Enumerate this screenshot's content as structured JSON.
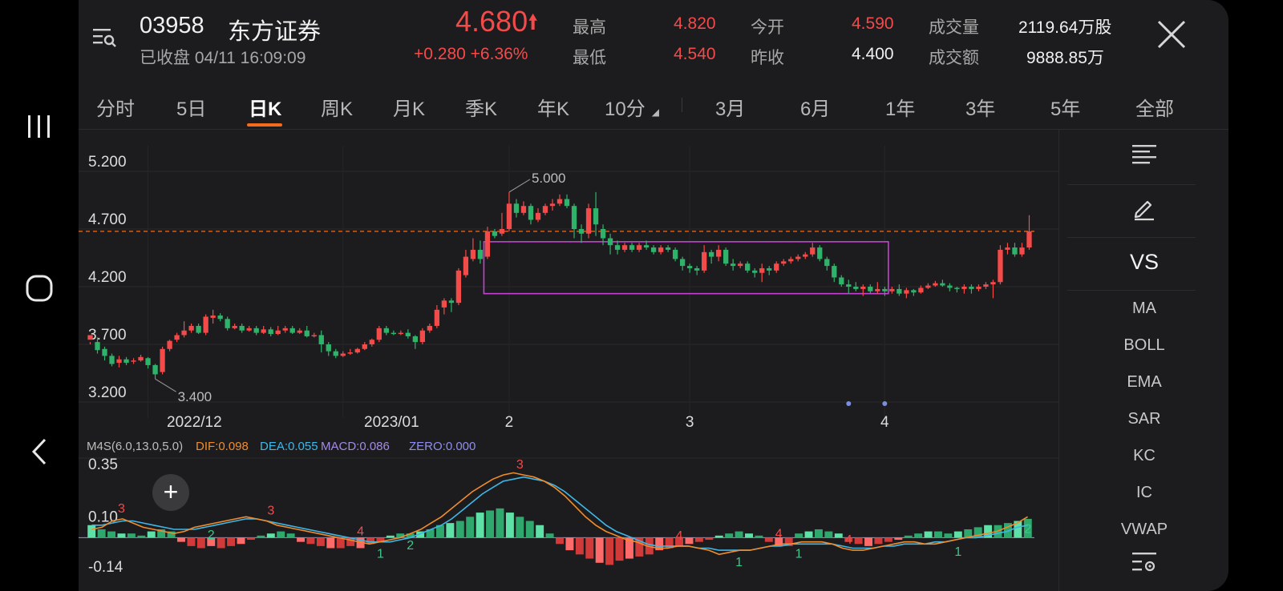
{
  "stock": {
    "code": "03958",
    "name": "东方证券",
    "status": "已收盘 04/11 16:09:09",
    "price": "4.680",
    "change": "+0.280",
    "change_pct": "+6.36%"
  },
  "stats": {
    "high_label": "最高",
    "high": "4.820",
    "low_label": "最低",
    "low": "4.540",
    "open_label": "今开",
    "open": "4.590",
    "prev_label": "昨收",
    "prev": "4.400",
    "vol_label": "成交量",
    "vol": "2119.64万股",
    "amt_label": "成交额",
    "amt": "9888.85万"
  },
  "tabs": [
    "分时",
    "5日",
    "日K",
    "周K",
    "月K",
    "季K",
    "年K",
    "10分",
    "3月",
    "6月",
    "1年",
    "3年",
    "5年",
    "全部"
  ],
  "active_tab": "日K",
  "tools": {
    "vs": "VS",
    "indicators": [
      "MA",
      "BOLL",
      "EMA",
      "SAR",
      "KC",
      "IC",
      "VWAP"
    ]
  },
  "colors": {
    "up": "#f34a4a",
    "down": "#2fb36b",
    "accent": "#f56a1c",
    "box": "#c83fd6",
    "dif": "#f08c2c",
    "dea": "#3fb7e8",
    "macd": "#a48be3",
    "zero": "#8e8ef0"
  },
  "chart_data": {
    "type": "candlestick",
    "y_ticks": [
      "5.200",
      "4.700",
      "4.200",
      "3.700",
      "3.200"
    ],
    "y_tick_values": [
      5.2,
      4.7,
      4.2,
      3.7,
      3.2
    ],
    "ylim": [
      3.2,
      5.2
    ],
    "x_labels": [
      "2022/12",
      "2023/01",
      "2",
      "3",
      "4"
    ],
    "reference_price": 4.68,
    "annotations": [
      {
        "text": "5.000",
        "value": 5.0
      },
      {
        "text": "3.400",
        "value": 3.4
      }
    ],
    "box": {
      "from_index": 55,
      "to_index": 110,
      "top": 4.59,
      "bottom": 4.14
    },
    "candles": [
      [
        3.74,
        3.78,
        3.72,
        3.7
      ],
      [
        3.72,
        3.65,
        3.76,
        3.62
      ],
      [
        3.66,
        3.6,
        3.68,
        3.56
      ],
      [
        3.6,
        3.53,
        3.62,
        3.51
      ],
      [
        3.54,
        3.57,
        3.6,
        3.5
      ],
      [
        3.57,
        3.54,
        3.59,
        3.52
      ],
      [
        3.55,
        3.56,
        3.58,
        3.53
      ],
      [
        3.56,
        3.59,
        3.61,
        3.55
      ],
      [
        3.58,
        3.52,
        3.59,
        3.49
      ],
      [
        3.52,
        3.44,
        3.53,
        3.4
      ],
      [
        3.46,
        3.66,
        3.68,
        3.44
      ],
      [
        3.66,
        3.73,
        3.74,
        3.64
      ],
      [
        3.74,
        3.78,
        3.8,
        3.72
      ],
      [
        3.78,
        3.82,
        3.9,
        3.76
      ],
      [
        3.82,
        3.86,
        3.88,
        3.8
      ],
      [
        3.86,
        3.8,
        3.88,
        3.79
      ],
      [
        3.8,
        3.94,
        3.96,
        3.78
      ],
      [
        3.93,
        3.95,
        4.0,
        3.88
      ],
      [
        3.95,
        3.92,
        3.97,
        3.9
      ],
      [
        3.92,
        3.84,
        3.94,
        3.82
      ],
      [
        3.84,
        3.86,
        3.88,
        3.83
      ],
      [
        3.86,
        3.82,
        3.88,
        3.8
      ],
      [
        3.82,
        3.84,
        3.86,
        3.81
      ],
      [
        3.84,
        3.8,
        3.86,
        3.78
      ],
      [
        3.8,
        3.83,
        3.86,
        3.79
      ],
      [
        3.83,
        3.79,
        3.85,
        3.77
      ],
      [
        3.79,
        3.82,
        3.86,
        3.78
      ],
      [
        3.82,
        3.84,
        3.86,
        3.8
      ],
      [
        3.84,
        3.8,
        3.86,
        3.79
      ],
      [
        3.8,
        3.82,
        3.84,
        3.79
      ],
      [
        3.82,
        3.77,
        3.86,
        3.76
      ],
      [
        3.77,
        3.78,
        3.8,
        3.76
      ],
      [
        3.78,
        3.7,
        3.82,
        3.63
      ],
      [
        3.7,
        3.64,
        3.72,
        3.6
      ],
      [
        3.64,
        3.6,
        3.66,
        3.58
      ],
      [
        3.6,
        3.62,
        3.64,
        3.59
      ],
      [
        3.62,
        3.63,
        3.66,
        3.61
      ],
      [
        3.63,
        3.66,
        3.67,
        3.62
      ],
      [
        3.66,
        3.7,
        3.72,
        3.65
      ],
      [
        3.7,
        3.74,
        3.75,
        3.68
      ],
      [
        3.74,
        3.84,
        3.86,
        3.72
      ],
      [
        3.84,
        3.8,
        3.86,
        3.78
      ],
      [
        3.8,
        3.79,
        3.82,
        3.78
      ],
      [
        3.79,
        3.8,
        3.82,
        3.78
      ],
      [
        3.8,
        3.77,
        3.83,
        3.75
      ],
      [
        3.77,
        3.72,
        3.78,
        3.66
      ],
      [
        3.72,
        3.82,
        3.84,
        3.7
      ],
      [
        3.82,
        3.86,
        3.88,
        3.8
      ],
      [
        3.86,
        4.0,
        4.04,
        3.84
      ],
      [
        4.02,
        4.08,
        4.1,
        3.96
      ],
      [
        4.08,
        4.06,
        4.1,
        3.98
      ],
      [
        4.06,
        4.34,
        4.36,
        4.04
      ],
      [
        4.3,
        4.46,
        4.52,
        4.28
      ],
      [
        4.44,
        4.52,
        4.62,
        4.42
      ],
      [
        4.52,
        4.44,
        4.6,
        4.4
      ],
      [
        4.46,
        4.68,
        4.72,
        4.44
      ],
      [
        4.68,
        4.64,
        4.7,
        4.62
      ],
      [
        4.66,
        4.7,
        4.84,
        4.64
      ],
      [
        4.7,
        4.92,
        5.02,
        4.68
      ],
      [
        4.92,
        4.84,
        4.96,
        4.8
      ],
      [
        4.84,
        4.9,
        4.94,
        4.82
      ],
      [
        4.9,
        4.78,
        4.92,
        4.74
      ],
      [
        4.78,
        4.84,
        4.88,
        4.76
      ],
      [
        4.84,
        4.9,
        4.92,
        4.82
      ],
      [
        4.9,
        4.92,
        4.96,
        4.86
      ],
      [
        4.92,
        4.96,
        5.0,
        4.9
      ],
      [
        4.96,
        4.9,
        5.0,
        4.88
      ],
      [
        4.9,
        4.7,
        4.92,
        4.62
      ],
      [
        4.7,
        4.66,
        4.74,
        4.58
      ],
      [
        4.66,
        4.88,
        4.92,
        4.62
      ],
      [
        4.88,
        4.74,
        5.02,
        4.64
      ],
      [
        4.7,
        4.62,
        4.74,
        4.56
      ],
      [
        4.62,
        4.56,
        4.66,
        4.48
      ],
      [
        4.56,
        4.52,
        4.6,
        4.48
      ],
      [
        4.52,
        4.56,
        4.58,
        4.5
      ],
      [
        4.56,
        4.52,
        4.58,
        4.5
      ],
      [
        4.52,
        4.56,
        4.58,
        4.5
      ],
      [
        4.56,
        4.54,
        4.6,
        4.52
      ],
      [
        4.54,
        4.5,
        4.56,
        4.48
      ],
      [
        4.5,
        4.54,
        4.56,
        4.48
      ],
      [
        4.54,
        4.52,
        4.56,
        4.5
      ],
      [
        4.52,
        4.44,
        4.54,
        4.42
      ],
      [
        4.44,
        4.38,
        4.46,
        4.34
      ],
      [
        4.38,
        4.36,
        4.4,
        4.32
      ],
      [
        4.36,
        4.34,
        4.38,
        4.3
      ],
      [
        4.34,
        4.5,
        4.56,
        4.32
      ],
      [
        4.5,
        4.46,
        4.52,
        4.4
      ],
      [
        4.46,
        4.52,
        4.56,
        4.42
      ],
      [
        4.52,
        4.4,
        4.54,
        4.38
      ],
      [
        4.4,
        4.38,
        4.44,
        4.34
      ],
      [
        4.38,
        4.4,
        4.42,
        4.36
      ],
      [
        4.4,
        4.34,
        4.42,
        4.32
      ],
      [
        4.34,
        4.32,
        4.36,
        4.28
      ],
      [
        4.32,
        4.36,
        4.4,
        4.24
      ],
      [
        4.36,
        4.34,
        4.38,
        4.3
      ],
      [
        4.34,
        4.4,
        4.42,
        4.32
      ],
      [
        4.4,
        4.42,
        4.44,
        4.38
      ],
      [
        4.42,
        4.44,
        4.46,
        4.4
      ],
      [
        4.44,
        4.46,
        4.48,
        4.42
      ],
      [
        4.46,
        4.48,
        4.5,
        4.44
      ],
      [
        4.48,
        4.54,
        4.58,
        4.46
      ],
      [
        4.54,
        4.44,
        4.56,
        4.42
      ],
      [
        4.44,
        4.38,
        4.46,
        4.34
      ],
      [
        4.38,
        4.28,
        4.4,
        4.24
      ],
      [
        4.28,
        4.22,
        4.3,
        4.2
      ],
      [
        4.22,
        4.2,
        4.26,
        4.14
      ],
      [
        4.2,
        4.18,
        4.24,
        4.16
      ],
      [
        4.18,
        4.2,
        4.22,
        4.12
      ],
      [
        4.2,
        4.16,
        4.22,
        4.14
      ],
      [
        4.16,
        4.18,
        4.24,
        4.14
      ],
      [
        4.18,
        4.16,
        4.2,
        4.12
      ],
      [
        4.16,
        4.18,
        4.2,
        4.14
      ],
      [
        4.18,
        4.14,
        4.22,
        4.12
      ],
      [
        4.14,
        4.17,
        4.19,
        4.1
      ],
      [
        4.17,
        4.15,
        4.18,
        4.12
      ],
      [
        4.15,
        4.19,
        4.21,
        4.14
      ],
      [
        4.19,
        4.21,
        4.23,
        4.18
      ],
      [
        4.21,
        4.23,
        4.25,
        4.2
      ],
      [
        4.23,
        4.21,
        4.26,
        4.2
      ],
      [
        4.21,
        4.19,
        4.23,
        4.16
      ],
      [
        4.19,
        4.18,
        4.2,
        4.15
      ],
      [
        4.18,
        4.2,
        4.22,
        4.14
      ],
      [
        4.2,
        4.18,
        4.22,
        4.14
      ],
      [
        4.18,
        4.2,
        4.22,
        4.16
      ],
      [
        4.2,
        4.22,
        4.24,
        4.18
      ],
      [
        4.22,
        4.24,
        4.26,
        4.1
      ],
      [
        4.24,
        4.52,
        4.56,
        4.22
      ],
      [
        4.52,
        4.54,
        4.58,
        4.48
      ],
      [
        4.54,
        4.48,
        4.58,
        4.46
      ],
      [
        4.48,
        4.54,
        4.58,
        4.46
      ],
      [
        4.54,
        4.68,
        4.82,
        4.52
      ]
    ],
    "macd": {
      "legend": {
        "name": "M4S(6.0,13.0,5.0)",
        "dif": "DIF:0.098",
        "dea": "DEA:0.055",
        "macd": "MACD:0.086",
        "zero": "ZERO:0.000"
      },
      "y_ticks": [
        "0.35",
        "0.10",
        "-0.14"
      ],
      "y_tick_values": [
        0.35,
        0.1,
        -0.14
      ],
      "ylim": [
        -0.14,
        0.35
      ],
      "dif": [
        0.04,
        0.05,
        0.08,
        0.09,
        0.07,
        0.05,
        0.04,
        0.03,
        0.02,
        0.03,
        0.05,
        0.06,
        0.07,
        0.08,
        0.09,
        0.1,
        0.09,
        0.08,
        0.06,
        0.05,
        0.04,
        0.03,
        0.02,
        0.01,
        0.0,
        -0.01,
        -0.02,
        -0.03,
        -0.02,
        -0.01,
        0.0,
        0.02,
        0.04,
        0.07,
        0.1,
        0.14,
        0.18,
        0.22,
        0.25,
        0.28,
        0.3,
        0.31,
        0.3,
        0.29,
        0.27,
        0.24,
        0.2,
        0.15,
        0.1,
        0.06,
        0.03,
        0.01,
        -0.01,
        -0.02,
        -0.04,
        -0.05,
        -0.05,
        -0.04,
        -0.04,
        -0.05,
        -0.06,
        -0.08,
        -0.07,
        -0.06,
        -0.06,
        -0.05,
        -0.04,
        -0.03,
        -0.03,
        -0.02,
        -0.02,
        -0.02,
        -0.03,
        -0.05,
        -0.06,
        -0.06,
        -0.05,
        -0.04,
        -0.03,
        -0.02,
        -0.02,
        -0.03,
        -0.03,
        -0.02,
        -0.01,
        0.0,
        0.01,
        0.02,
        0.03,
        0.05,
        0.07,
        0.1
      ],
      "dea": [
        0.06,
        0.06,
        0.07,
        0.08,
        0.08,
        0.07,
        0.06,
        0.05,
        0.04,
        0.04,
        0.04,
        0.05,
        0.06,
        0.07,
        0.08,
        0.09,
        0.09,
        0.08,
        0.07,
        0.06,
        0.05,
        0.04,
        0.03,
        0.02,
        0.01,
        0.0,
        -0.01,
        -0.02,
        -0.02,
        -0.02,
        -0.01,
        0.0,
        0.02,
        0.04,
        0.06,
        0.09,
        0.13,
        0.17,
        0.21,
        0.24,
        0.27,
        0.28,
        0.29,
        0.28,
        0.27,
        0.25,
        0.22,
        0.18,
        0.14,
        0.1,
        0.06,
        0.03,
        0.01,
        -0.01,
        -0.03,
        -0.04,
        -0.04,
        -0.04,
        -0.04,
        -0.05,
        -0.05,
        -0.06,
        -0.06,
        -0.06,
        -0.06,
        -0.05,
        -0.04,
        -0.04,
        -0.03,
        -0.03,
        -0.03,
        -0.03,
        -0.03,
        -0.04,
        -0.05,
        -0.05,
        -0.05,
        -0.04,
        -0.04,
        -0.03,
        -0.03,
        -0.03,
        -0.02,
        -0.02,
        -0.01,
        0.0,
        0.0,
        0.01,
        0.02,
        0.03,
        0.05,
        0.06
      ],
      "bars": [
        0.06,
        0.04,
        0.03,
        0.02,
        0.02,
        0.01,
        0.03,
        0.04,
        0.03,
        -0.02,
        -0.04,
        -0.05,
        -0.04,
        -0.05,
        -0.04,
        -0.03,
        -0.01,
        0.01,
        0.02,
        0.03,
        0.02,
        -0.02,
        -0.03,
        -0.04,
        -0.05,
        -0.05,
        -0.04,
        -0.05,
        -0.03,
        -0.02,
        0.01,
        0.02,
        0.02,
        0.03,
        0.04,
        0.06,
        0.07,
        0.08,
        0.1,
        0.12,
        0.13,
        0.14,
        0.12,
        0.1,
        0.08,
        0.06,
        0.02,
        -0.03,
        -0.06,
        -0.08,
        -0.1,
        -0.12,
        -0.13,
        -0.11,
        -0.1,
        -0.09,
        -0.08,
        -0.06,
        -0.05,
        -0.04,
        -0.03,
        -0.02,
        -0.01,
        0.01,
        0.02,
        0.03,
        0.02,
        0.01,
        -0.02,
        -0.04,
        -0.04,
        0.02,
        0.03,
        0.04,
        0.03,
        0.02,
        -0.02,
        -0.03,
        -0.04,
        -0.03,
        -0.02,
        -0.01,
        0.01,
        0.02,
        0.03,
        0.03,
        0.02,
        0.03,
        0.04,
        0.05,
        0.06,
        0.06,
        0.07,
        0.08,
        0.09
      ],
      "signals": [
        {
          "text": "3",
          "side": "up",
          "index": 3
        },
        {
          "text": "2",
          "side": "down",
          "index": 12
        },
        {
          "text": "3",
          "side": "up",
          "index": 17
        },
        {
          "text": "4",
          "side": "up",
          "index": 26
        },
        {
          "text": "1",
          "side": "down",
          "index": 28
        },
        {
          "text": "2",
          "side": "down",
          "index": 31
        },
        {
          "text": "3",
          "side": "up",
          "index": 42
        },
        {
          "text": "4",
          "side": "up",
          "index": 57
        },
        {
          "text": "1",
          "side": "down",
          "index": 63
        },
        {
          "text": "4",
          "side": "up",
          "index": 67
        },
        {
          "text": "1",
          "side": "down",
          "index": 69
        },
        {
          "text": "4",
          "side": "up",
          "index": 74
        },
        {
          "text": "1",
          "side": "down",
          "index": 84
        },
        {
          "text": "2",
          "side": "down",
          "index": 91
        }
      ]
    }
  }
}
